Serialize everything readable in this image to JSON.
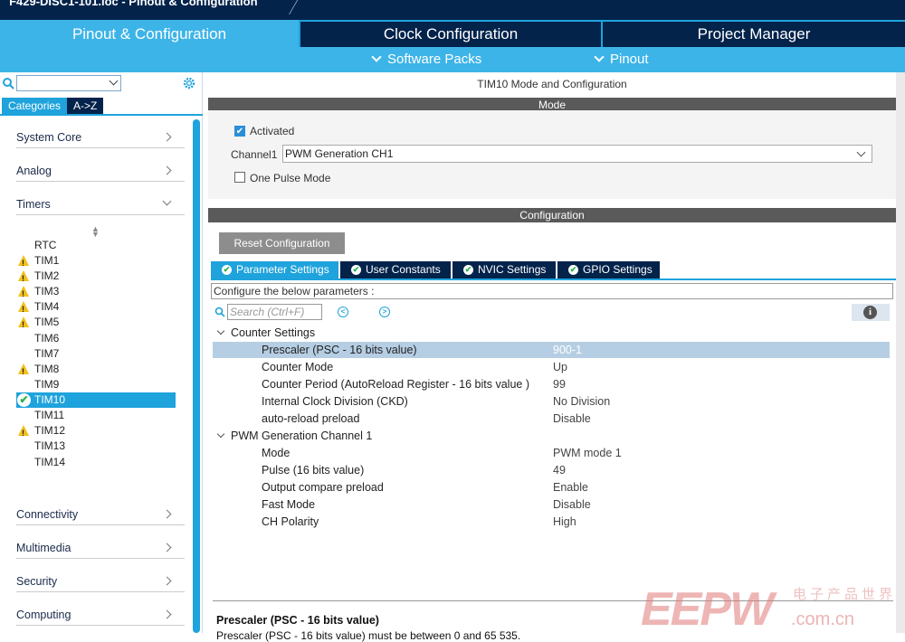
{
  "window": {
    "title": "F429-DISC1-101.ioc - Pinout & Configuration"
  },
  "main_tabs": [
    {
      "label": "Pinout & Configuration"
    },
    {
      "label": "Clock Configuration"
    },
    {
      "label": "Project Manager"
    }
  ],
  "sub_menu": {
    "software_packs": "Software Packs",
    "pinout": "Pinout"
  },
  "sidebar": {
    "search_value": "",
    "tabs": {
      "categories": "Categories",
      "az": "A->Z"
    },
    "categories": [
      {
        "label": "System Core"
      },
      {
        "label": "Analog"
      },
      {
        "label": "Timers"
      },
      {
        "label": "Connectivity"
      },
      {
        "label": "Multimedia"
      },
      {
        "label": "Security"
      },
      {
        "label": "Computing"
      }
    ],
    "timers": [
      {
        "label": "RTC",
        "status": "none"
      },
      {
        "label": "TIM1",
        "status": "warning"
      },
      {
        "label": "TIM2",
        "status": "warning"
      },
      {
        "label": "TIM3",
        "status": "warning"
      },
      {
        "label": "TIM4",
        "status": "warning"
      },
      {
        "label": "TIM5",
        "status": "warning"
      },
      {
        "label": "TIM6",
        "status": "none"
      },
      {
        "label": "TIM7",
        "status": "none"
      },
      {
        "label": "TIM8",
        "status": "warning"
      },
      {
        "label": "TIM9",
        "status": "none"
      },
      {
        "label": "TIM10",
        "status": "ok",
        "selected": true
      },
      {
        "label": "TIM11",
        "status": "none"
      },
      {
        "label": "TIM12",
        "status": "warning"
      },
      {
        "label": "TIM13",
        "status": "none"
      },
      {
        "label": "TIM14",
        "status": "none"
      }
    ]
  },
  "panel": {
    "title": "TIM10 Mode and Configuration",
    "mode_header": "Mode",
    "activated_label": "Activated",
    "activated_checked": true,
    "channel1_label": "Channel1",
    "channel1_value": "PWM Generation CH1",
    "one_pulse_label": "One Pulse Mode",
    "one_pulse_checked": false,
    "config_header": "Configuration",
    "reset_button": "Reset Configuration",
    "tabs": [
      {
        "label": "Parameter Settings"
      },
      {
        "label": "User Constants"
      },
      {
        "label": "NVIC Settings"
      },
      {
        "label": "GPIO Settings"
      }
    ],
    "configure_text": "Configure the below parameters :",
    "search_placeholder": "Search (Ctrl+F)",
    "groups": [
      {
        "label": "Counter Settings",
        "params": [
          {
            "name": "Prescaler (PSC - 16 bits value)",
            "value": "900-1"
          },
          {
            "name": "Counter Mode",
            "value": "Up"
          },
          {
            "name": "Counter Period (AutoReload Register - 16 bits value )",
            "value": "99"
          },
          {
            "name": "Internal Clock Division (CKD)",
            "value": "No Division"
          },
          {
            "name": "auto-reload preload",
            "value": "Disable"
          }
        ]
      },
      {
        "label": "PWM Generation Channel 1",
        "params": [
          {
            "name": "Mode",
            "value": "PWM mode 1"
          },
          {
            "name": "Pulse (16 bits value)",
            "value": "49"
          },
          {
            "name": "Output compare preload",
            "value": "Enable"
          },
          {
            "name": "Fast Mode",
            "value": "Disable"
          },
          {
            "name": "CH Polarity",
            "value": "High"
          }
        ]
      }
    ],
    "description_title": "Prescaler (PSC - 16 bits value)",
    "description_text": "Prescaler (PSC - 16 bits value) must be between 0 and 65 535."
  },
  "watermark": {
    "big": "EEPW",
    "domain": ".com.cn",
    "cn": "电子产品世界"
  },
  "colors": {
    "accent": "#1fa3dc",
    "dark": "#03234b",
    "warning": "#f2c01c",
    "ok": "#2bb14a"
  }
}
